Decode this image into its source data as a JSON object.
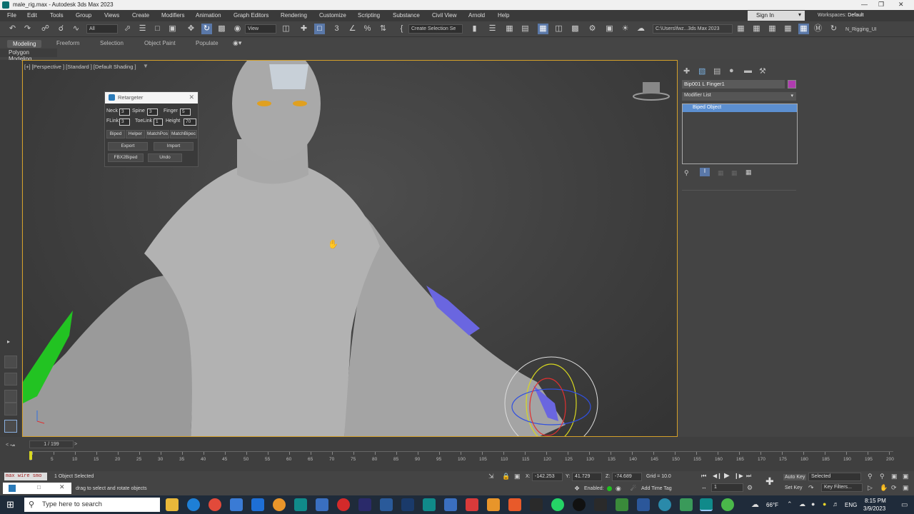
{
  "window": {
    "title": "male_rig.max - Autodesk 3ds Max 2023"
  },
  "menu": [
    "File",
    "Edit",
    "Tools",
    "Group",
    "Views",
    "Create",
    "Modifiers",
    "Animation",
    "Graph Editors",
    "Rendering",
    "Customize",
    "Scripting",
    "Substance",
    "Civil View",
    "Arnold",
    "Help"
  ],
  "account": {
    "signin": "Sign In",
    "workspaces_label": "Workspaces:",
    "workspace_value": "Default"
  },
  "toolbar": {
    "filter": "All",
    "refcoord": "View",
    "selection_set": "Create Selection Se",
    "path": "C:\\Users\\fwz...3ds Max 2023",
    "project": "N_Rigging_UI"
  },
  "ribbon": {
    "tabs": [
      "Modeling",
      "Freeform",
      "Selection",
      "Object Paint",
      "Populate"
    ],
    "active": "Modeling",
    "panel": "Polygon Modeling"
  },
  "viewport": {
    "label": "[+] [Perspective ] [Standard ] [Default Shading ]"
  },
  "retargeter": {
    "title": "Retargeter",
    "neck_label": "Neck",
    "neck": "3",
    "spine_label": "Spine",
    "spine": "3",
    "finger_label": "Finger",
    "finger": "5",
    "flink_label": "FLink",
    "flink": "3",
    "toelink_label": "ToeLink",
    "toelink": "1",
    "height_label": "Height",
    "height": "70",
    "buttons": [
      "Biped",
      "Helper",
      "MatchPos",
      "MatchBipec"
    ],
    "export": "Export",
    "import": "Import",
    "fbx2biped": "FBX2Biped",
    "undo": "Undo"
  },
  "command_panel": {
    "object_name": "Bip001 L Finger1",
    "object_color": "#b03cb0",
    "modifier_list": "Modifier List",
    "stack_item": "Biped Object"
  },
  "timeline": {
    "slider": "1 / 199",
    "ticks": [
      "0",
      "5",
      "10",
      "15",
      "20",
      "25",
      "30",
      "35",
      "40",
      "45",
      "50",
      "55",
      "60",
      "65",
      "70",
      "75",
      "80",
      "85",
      "90",
      "95",
      "100",
      "105",
      "110",
      "115",
      "120",
      "125",
      "130",
      "135",
      "140",
      "145",
      "150",
      "155",
      "160",
      "165",
      "170",
      "175",
      "180",
      "185",
      "190",
      "195",
      "200"
    ]
  },
  "status": {
    "listener": "max wire smo",
    "selected": "1 Object Selected",
    "prompt": "drag to select and rotate objects",
    "x_label": "X:",
    "x": "-142.253",
    "y_label": "Y:",
    "y": "41.729",
    "z_label": "Z:",
    "z": "-74.689",
    "grid": "Grid = 10.0",
    "enabled": "Enabled:",
    "add_time_tag": "Add Time Tag",
    "frame": "1",
    "auto_key": "Auto Key",
    "set_key": "Set Key",
    "key_mode": "Selected",
    "key_filters": "Key Filters..."
  },
  "taskbar": {
    "search": "Type here to search",
    "weather": "66°F",
    "lang": "ENG",
    "time": "8:15 PM",
    "date": "3/9/2023"
  }
}
